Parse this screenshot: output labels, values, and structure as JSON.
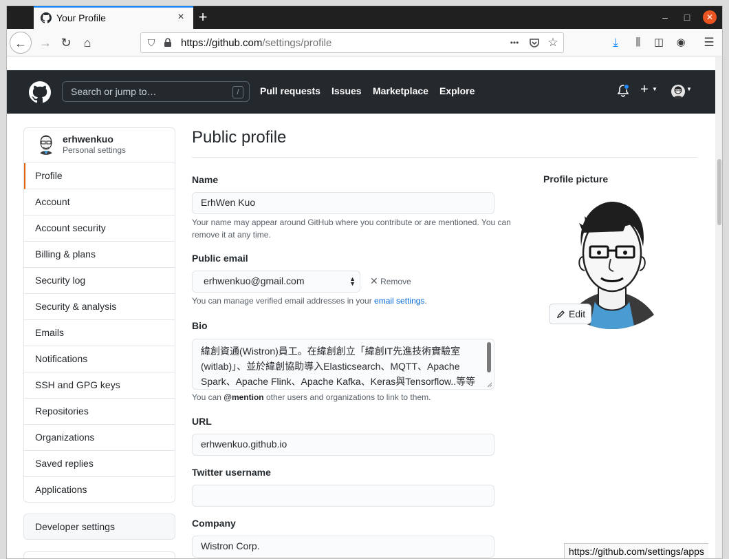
{
  "browser": {
    "tab_title": "Your Profile",
    "tab_close": "×",
    "new_tab": "+",
    "url_host": "https://github.com",
    "url_path": "/settings/profile",
    "url_more": "•••",
    "status_link": "https://github.com/settings/apps",
    "accent": "#0a84ff",
    "close_color": "#e95420"
  },
  "github": {
    "search_placeholder": "Search or jump to…",
    "search_key": "/",
    "nav": [
      "Pull requests",
      "Issues",
      "Marketplace",
      "Explore"
    ],
    "plus": "+",
    "header_bg": "#24292e",
    "notification_dot": "#2188ff"
  },
  "sidebar": {
    "username": "erhwenkuo",
    "subtitle": "Personal settings",
    "items": [
      {
        "label": "Profile",
        "active": true
      },
      {
        "label": "Account"
      },
      {
        "label": "Account security"
      },
      {
        "label": "Billing & plans"
      },
      {
        "label": "Security log"
      },
      {
        "label": "Security & analysis"
      },
      {
        "label": "Emails"
      },
      {
        "label": "Notifications"
      },
      {
        "label": "SSH and GPG keys"
      },
      {
        "label": "Repositories"
      },
      {
        "label": "Organizations"
      },
      {
        "label": "Saved replies"
      },
      {
        "label": "Applications"
      }
    ],
    "developer_settings": "Developer settings",
    "active_accent": "#e36209"
  },
  "main": {
    "title": "Public profile",
    "name_label": "Name",
    "name_value": "ErhWen Kuo",
    "name_note_1": "Your name may appear around GitHub where you contribute or are mentioned. You can",
    "name_note_2": "remove it at any time.",
    "email_label": "Public email",
    "email_value": "erhwenkuo@gmail.com",
    "remove_label": "Remove",
    "email_note_prefix": "You can manage verified email addresses in your ",
    "email_note_link": "email settings",
    "email_note_suffix": ".",
    "bio_label": "Bio",
    "bio_line_1": "緯創資通(Wistron)員工。在緯創創立「緯創IT先進技術實驗室",
    "bio_line_2": "(witlab)」、並於緯創協助導入Elasticsearch、MQTT、Apache",
    "bio_line_3": "Spark、Apache Flink、Apache Kafka、Keras與Tensorflow..等等",
    "bio_note_prefix": "You can ",
    "bio_note_mention": "@mention",
    "bio_note_suffix": " other users and organizations to link to them.",
    "url_label": "URL",
    "url_value": "erhwenkuo.github.io",
    "twitter_label": "Twitter username",
    "twitter_value": "",
    "company_label": "Company",
    "company_value": "Wistron Corp."
  },
  "picture": {
    "label": "Profile picture",
    "edit_label": "Edit"
  }
}
